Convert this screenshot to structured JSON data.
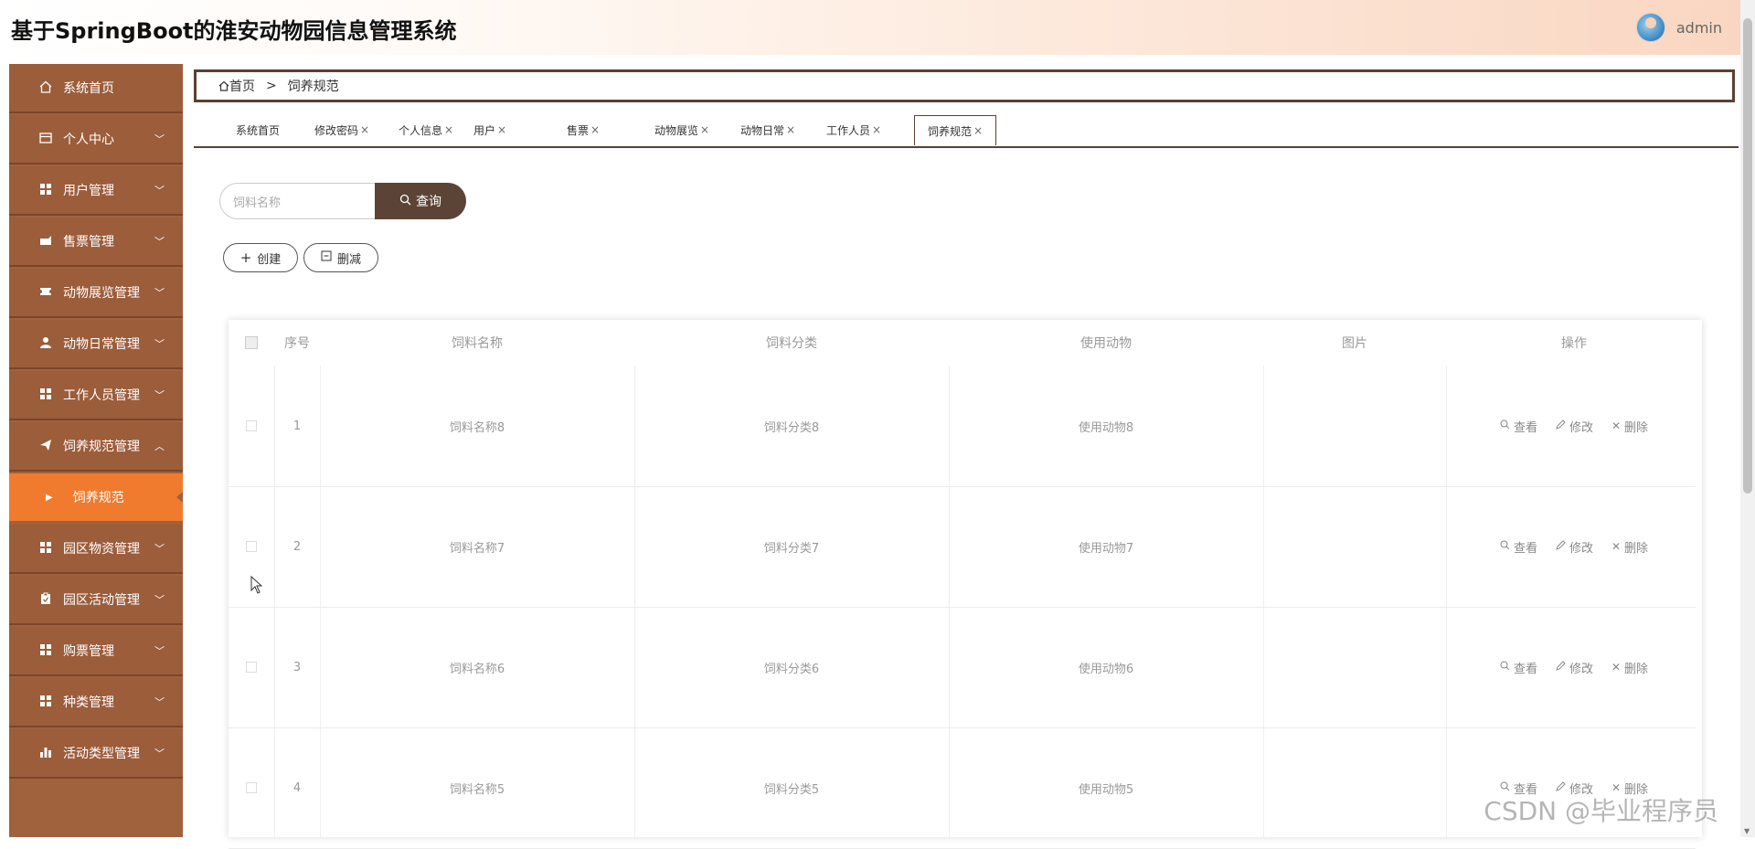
{
  "header": {
    "title": "基于SpringBoot的淮安动物园信息管理系统",
    "username": "admin"
  },
  "sidebar": {
    "items": [
      {
        "label": "系统首页",
        "icon": "home-icon",
        "expandable": false
      },
      {
        "label": "个人中心",
        "icon": "card-icon",
        "expandable": true
      },
      {
        "label": "用户管理",
        "icon": "grid-icon",
        "expandable": true
      },
      {
        "label": "售票管理",
        "icon": "ticket-icon",
        "expandable": true
      },
      {
        "label": "动物展览管理",
        "icon": "film-icon",
        "expandable": true
      },
      {
        "label": "动物日常管理",
        "icon": "person-icon",
        "expandable": true
      },
      {
        "label": "工作人员管理",
        "icon": "grid-icon",
        "expandable": true
      },
      {
        "label": "饲养规范管理",
        "icon": "send-icon",
        "expandable": true,
        "open": true
      },
      {
        "label": "饲养规范",
        "icon": "caret-right-icon",
        "sub": true
      },
      {
        "label": "园区物资管理",
        "icon": "grid-icon",
        "expandable": true
      },
      {
        "label": "园区活动管理",
        "icon": "clipboard-icon",
        "expandable": true
      },
      {
        "label": "购票管理",
        "icon": "grid-icon",
        "expandable": true
      },
      {
        "label": "种类管理",
        "icon": "grid-icon",
        "expandable": true
      },
      {
        "label": "活动类型管理",
        "icon": "bar-chart-icon",
        "expandable": true
      }
    ]
  },
  "breadcrumb": {
    "home": "首页",
    "separator": ">",
    "current": "饲养规范"
  },
  "tabs": [
    {
      "label": "系统首页",
      "closable": false
    },
    {
      "label": "修改密码",
      "closable": true
    },
    {
      "label": "个人信息",
      "closable": true
    },
    {
      "label": "用户",
      "closable": true
    },
    {
      "label": "售票",
      "closable": true
    },
    {
      "label": "动物展览",
      "closable": true
    },
    {
      "label": "动物日常",
      "closable": true
    },
    {
      "label": "工作人员",
      "closable": true
    },
    {
      "label": "饲养规范",
      "closable": true,
      "active": true
    }
  ],
  "tab_close_glyph": "×",
  "search": {
    "placeholder": "饲料名称",
    "button_label": "查询"
  },
  "buttons": {
    "create": "创建",
    "delete": "删减"
  },
  "table": {
    "columns": [
      "序号",
      "饲料名称",
      "饲料分类",
      "使用动物",
      "图片",
      "操作"
    ],
    "rows": [
      {
        "index": "1",
        "name": "饲料名称8",
        "category": "饲料分类8",
        "animal": "使用动物8"
      },
      {
        "index": "2",
        "name": "饲料名称7",
        "category": "饲料分类7",
        "animal": "使用动物7"
      },
      {
        "index": "3",
        "name": "饲料名称6",
        "category": "饲料分类6",
        "animal": "使用动物6"
      },
      {
        "index": "4",
        "name": "饲料名称5",
        "category": "饲料分类5",
        "animal": "使用动物5"
      }
    ],
    "actions": {
      "view": "查看",
      "edit": "修改",
      "remove": "删除"
    }
  },
  "watermark": "CSDN @毕业程序员",
  "colors": {
    "sidebar": "#a0613d",
    "active_sub": "#f07b2e",
    "primary_dark": "#5b4436"
  }
}
